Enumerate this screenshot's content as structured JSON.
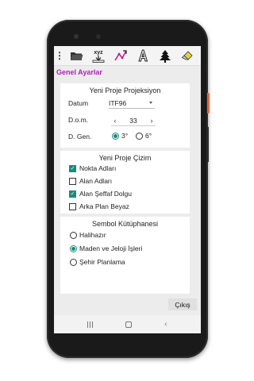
{
  "toolbar": {
    "menu_label": "⋮",
    "icons": [
      "folder-open-icon",
      "xyz-import-icon",
      "line-draw-icon",
      "text-a-icon",
      "tree-symbol-icon",
      "eraser-icon"
    ],
    "xyz_label": "xyz"
  },
  "page_title": "Genel Ayarlar",
  "projection": {
    "title": "Yeni Proje Projeksiyon",
    "datum_label": "Datum",
    "datum_value": "ITF96",
    "dom_label": "D.o.m.",
    "dom_value": "33",
    "dgen_label": "D. Gen.",
    "dgen_options": [
      {
        "label": "3°",
        "selected": true
      },
      {
        "label": "6°",
        "selected": false
      }
    ]
  },
  "drawing": {
    "title": "Yeni Proje Çizim",
    "options": [
      {
        "label": "Nokta Adları",
        "checked": true
      },
      {
        "label": "Alan Adları",
        "checked": false
      },
      {
        "label": "Alan Şeffaf Dolgu",
        "checked": true
      },
      {
        "label": "Arka Plan Beyaz",
        "checked": false
      }
    ]
  },
  "symbols": {
    "title": "Sembol Kütüphanesi",
    "options": [
      {
        "label": "Halihazır",
        "selected": false
      },
      {
        "label": "Maden ve Jeloji İşleri",
        "selected": true
      },
      {
        "label": "Şehir Planlama",
        "selected": false
      }
    ]
  },
  "exit_label": "Çıkış",
  "colors": {
    "title": "#b020c0",
    "accent": "#1a8a7a",
    "phone_side_button": "#e36a3c"
  }
}
